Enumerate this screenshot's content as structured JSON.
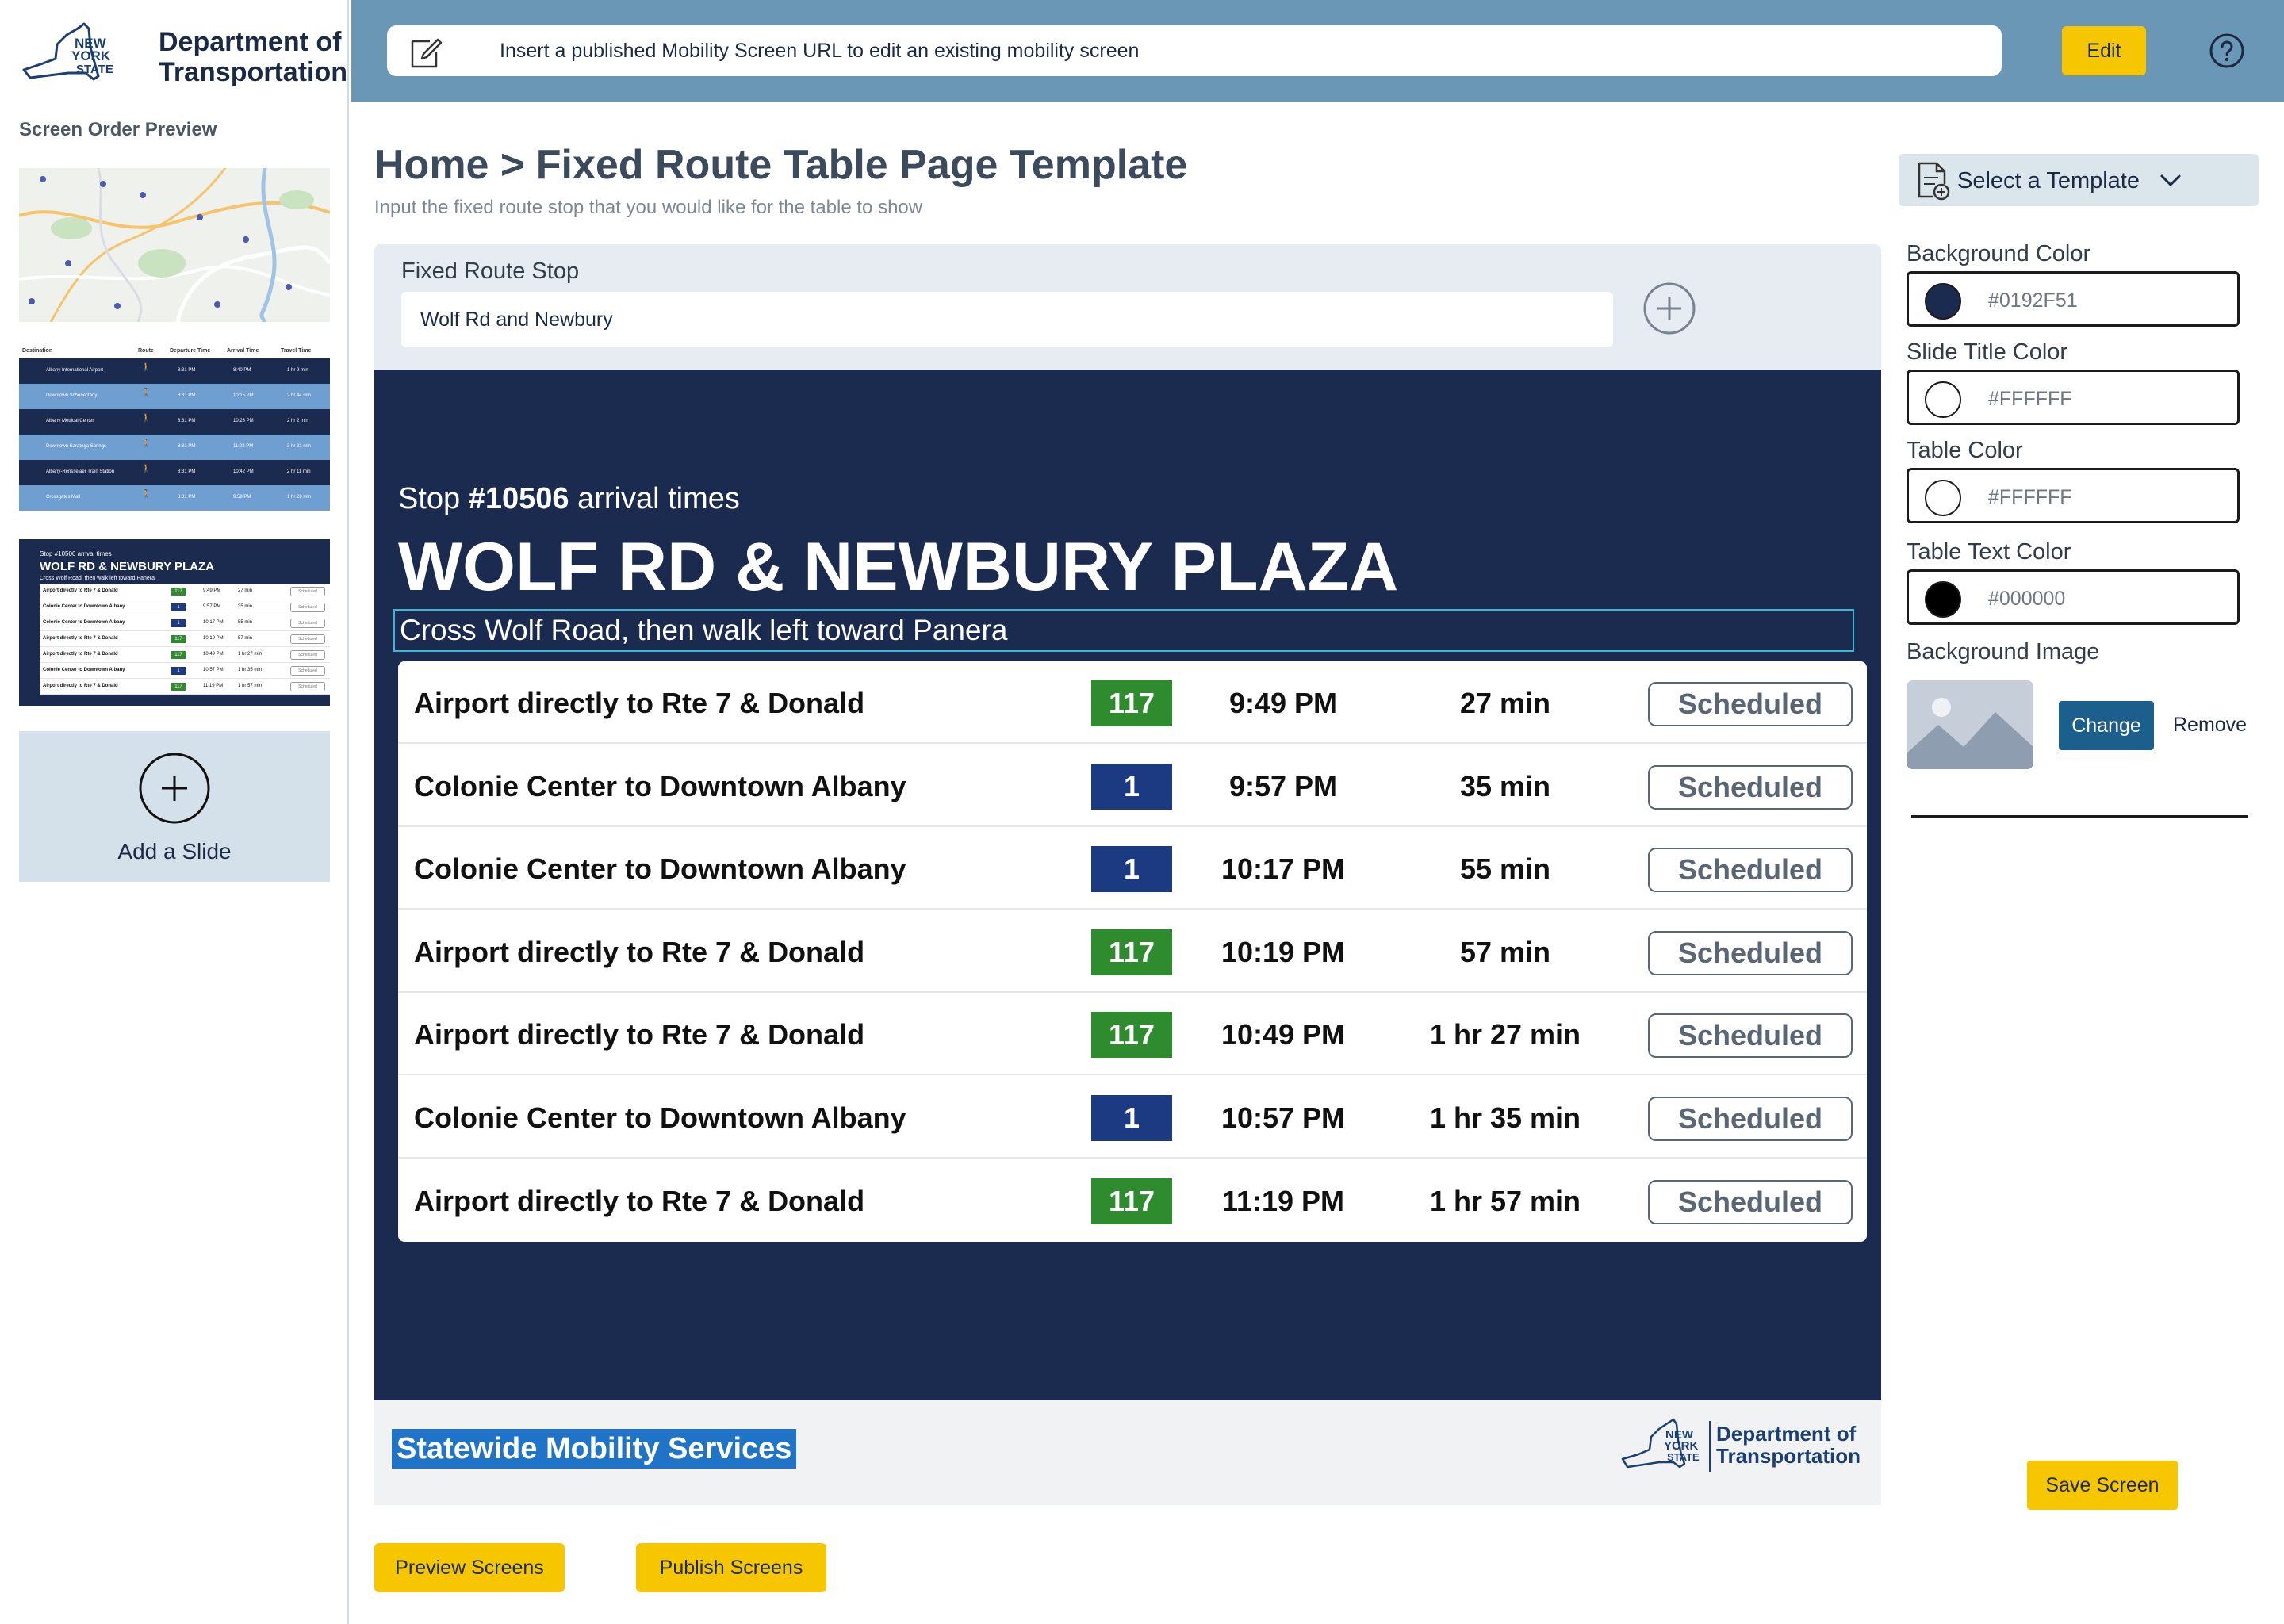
{
  "brand": {
    "org_name_line1": "Department of",
    "org_name_line2": "Transportation",
    "state_line1": "NEW",
    "state_line2": "YORK",
    "state_line3": "STATE"
  },
  "sidebar": {
    "heading": "Screen Order Preview",
    "add_slide_label": "Add a Slide",
    "table_thumb": {
      "headers": [
        "Destination",
        "Route",
        "Departure Time",
        "Arrival Time",
        "Travel Time"
      ],
      "rows": [
        [
          "Albany International Airport",
          "8:31 PM",
          "8:40 PM",
          "1 hr 9 min"
        ],
        [
          "Downtown Schenectady",
          "8:31 PM",
          "10:15 PM",
          "2 hr 44 min"
        ],
        [
          "Albany Medical Center",
          "8:31 PM",
          "10:23 PM",
          "2 hr 2 min"
        ],
        [
          "Downtown Saratoga Springs",
          "8:31 PM",
          "11:02 PM",
          "3 hr 31 min"
        ],
        [
          "Albany-Rensselaer Train Station",
          "8:31 PM",
          "10:42 PM",
          "2 hr 11 min"
        ],
        [
          "Crossgates Mall",
          "8:31 PM",
          "9:59 PM",
          "1 hr 28 min"
        ]
      ]
    },
    "slide_thumb": {
      "stop_line": "Stop #10506 arrival times",
      "title": "WOLF RD & NEWBURY PLAZA",
      "instruction": "Cross Wolf Road, then walk left toward Panera"
    }
  },
  "topbar": {
    "url_placeholder": "Insert a published Mobility Screen URL to edit an existing mobility screen",
    "edit_label": "Edit"
  },
  "main": {
    "breadcrumb": "Home > Fixed Route Table Page Template",
    "subtitle": "Input the fixed route stop that you would like for the table to show",
    "stop_label": "Fixed Route Stop",
    "stop_value": "Wolf Rd and Newbury"
  },
  "slide": {
    "stop_prefix": "Stop ",
    "stop_number": "#10506",
    "stop_suffix": " arrival times",
    "title": "WOLF RD & NEWBURY PLAZA",
    "instruction": "Cross Wolf Road, then walk left toward Panera",
    "arrivals": [
      {
        "destination": "Airport directly to Rte 7 & Donald",
        "route": "117",
        "route_color": "#2e8b2e",
        "time": "9:49 PM",
        "wait": "27 min",
        "status": "Scheduled"
      },
      {
        "destination": "Colonie Center to Downtown Albany",
        "route": "1",
        "route_color": "#1b3a82",
        "time": "9:57 PM",
        "wait": "35 min",
        "status": "Scheduled"
      },
      {
        "destination": "Colonie Center to Downtown Albany",
        "route": "1",
        "route_color": "#1b3a82",
        "time": "10:17 PM",
        "wait": "55 min",
        "status": "Scheduled"
      },
      {
        "destination": "Airport directly to Rte 7 & Donald",
        "route": "117",
        "route_color": "#2e8b2e",
        "time": "10:19 PM",
        "wait": "57 min",
        "status": "Scheduled"
      },
      {
        "destination": "Airport directly to Rte 7 & Donald",
        "route": "117",
        "route_color": "#2e8b2e",
        "time": "10:49 PM",
        "wait": "1 hr 27 min",
        "status": "Scheduled"
      },
      {
        "destination": "Colonie Center to Downtown Albany",
        "route": "1",
        "route_color": "#1b3a82",
        "time": "10:57 PM",
        "wait": "1 hr 35 min",
        "status": "Scheduled"
      },
      {
        "destination": "Airport directly to Rte 7 & Donald",
        "route": "117",
        "route_color": "#2e8b2e",
        "time": "11:19 PM",
        "wait": "1 hr 57 min",
        "status": "Scheduled"
      }
    ],
    "footer_brand": "Statewide Mobility Services"
  },
  "actions": {
    "preview_label": "Preview Screens",
    "publish_label": "Publish Screens",
    "save_label": "Save Screen"
  },
  "settings": {
    "template_label": "Select a Template",
    "background_color_label": "Background Color",
    "background_color": "#0192F51",
    "slide_title_color_label": "Slide Title Color",
    "slide_title_color": "#FFFFFF",
    "table_color_label": "Table Color",
    "table_color": "#FFFFFF",
    "table_text_color_label": "Table Text Color",
    "table_text_color": "#000000",
    "background_image_label": "Background Image",
    "change_label": "Change",
    "remove_label": "Remove",
    "swatches": {
      "background": "#1b2a4f",
      "slide_title": "#ffffff",
      "table": "#ffffff",
      "table_text": "#000000"
    }
  },
  "colors": {
    "accent_yellow": "#f6c700",
    "topbar_blue": "#6b97b6",
    "slide_navy": "#1b2a4f",
    "route_green": "#2e8b2e",
    "route_blue": "#1b3a82"
  }
}
